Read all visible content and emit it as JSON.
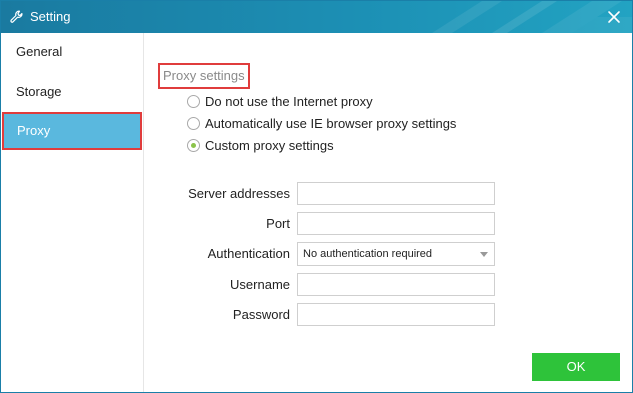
{
  "window": {
    "title": "Setting",
    "title_icon": "wrench-icon",
    "close_icon": "close-icon"
  },
  "sidebar": {
    "items": [
      {
        "label": "General",
        "active": false
      },
      {
        "label": "Storage",
        "active": false
      },
      {
        "label": "Proxy",
        "active": true
      }
    ]
  },
  "proxy": {
    "section_title": "Proxy settings",
    "options": [
      {
        "label": "Do not use the Internet proxy",
        "checked": false
      },
      {
        "label": "Automatically use IE browser proxy settings",
        "checked": false
      },
      {
        "label": "Custom proxy settings",
        "checked": true
      }
    ],
    "fields": {
      "server_label": "Server addresses",
      "server_value": "",
      "port_label": "Port",
      "port_value": "",
      "auth_label": "Authentication",
      "auth_value": "No authentication required",
      "username_label": "Username",
      "username_value": "",
      "password_label": "Password",
      "password_value": ""
    }
  },
  "footer": {
    "ok_label": "OK"
  },
  "colors": {
    "titlebar": "#1c8fb4",
    "active_nav": "#5ab8de",
    "highlight_border": "#e03c3c",
    "ok_button": "#2ec33a",
    "radio_checked": "#8bc34a"
  }
}
